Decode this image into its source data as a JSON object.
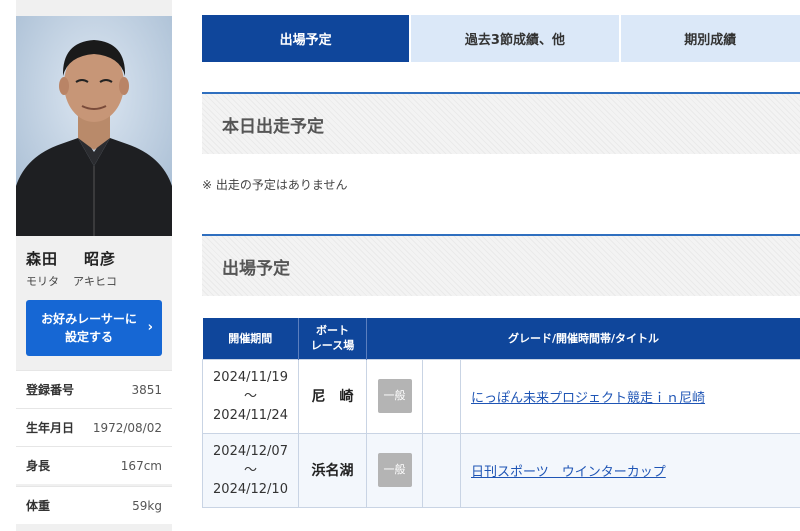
{
  "racer": {
    "name_family": "森田",
    "name_given": "昭彦",
    "kana_family": "モリタ",
    "kana_given": "アキヒコ",
    "favorite_button": "お好みレーサーに\n設定する",
    "favorite_icon": "chevron-right-icon",
    "info": [
      {
        "label": "登録番号",
        "value": "3851"
      },
      {
        "label": "生年月日",
        "value": "1972/08/02"
      },
      {
        "label": "身長",
        "value": "167cm"
      },
      {
        "label": "体重",
        "value": "59kg"
      }
    ]
  },
  "tabs": [
    {
      "label": "出場予定",
      "active": true
    },
    {
      "label": "過去3節成績、他",
      "active": false
    },
    {
      "label": "期別成績",
      "active": false
    }
  ],
  "today_section": {
    "title": "本日出走予定",
    "note": "※ 出走の予定はありません"
  },
  "schedule_section": {
    "title": "出場予定",
    "headers": {
      "period": "開催期間",
      "place_line1": "ボート",
      "place_line2": "レース場",
      "info": "グレード/開催時間帯/タイトル"
    },
    "rows": [
      {
        "start": "2024/11/19",
        "sep": "〜",
        "end": "2024/11/24",
        "place": "尼　崎",
        "grade": "一般",
        "title": "にっぽん未来プロジェクト競走ｉｎ尼崎"
      },
      {
        "start": "2024/12/07",
        "sep": "〜",
        "end": "2024/12/10",
        "place": "浜名湖",
        "grade": "一般",
        "title": "日刊スポーツ　ウインターカップ"
      }
    ]
  },
  "colors": {
    "navy": "#0f469b",
    "tab_inactive": "#dbe8f8",
    "button_blue": "#1667d4",
    "link": "#1f55b5",
    "grade_gray": "#b4b4b4"
  }
}
